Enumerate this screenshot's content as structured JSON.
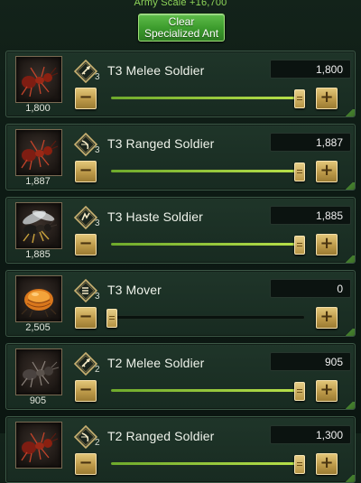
{
  "header": {
    "army_scale": "Army Scale +16,700",
    "clear_button": [
      "Clear",
      "Specialized Ant"
    ]
  },
  "units": [
    {
      "name": "T3 Melee Soldier",
      "tier": "3",
      "count": "1,800",
      "value": "1,800",
      "level": 0.97,
      "icon": "melee-tier-icon",
      "portrait": "red-ant-portrait"
    },
    {
      "name": "T3 Ranged Soldier",
      "tier": "3",
      "count": "1,887",
      "value": "1,887",
      "level": 0.97,
      "icon": "ranged-tier-icon",
      "portrait": "red-ant-portrait"
    },
    {
      "name": "T3 Haste Soldier",
      "tier": "3",
      "count": "1,885",
      "value": "1,885",
      "level": 0.97,
      "icon": "haste-tier-icon",
      "portrait": "winged-ant-portrait"
    },
    {
      "name": "T3 Mover",
      "tier": "3",
      "count": "2,505",
      "value": "0",
      "level": 0.0,
      "icon": "mover-tier-icon",
      "portrait": "honeypot-ant-portrait"
    },
    {
      "name": "T2 Melee Soldier",
      "tier": "2",
      "count": "905",
      "value": "905",
      "level": 0.97,
      "icon": "melee-tier-icon",
      "portrait": "black-ant-portrait"
    },
    {
      "name": "T2 Ranged Soldier",
      "tier": "2",
      "count": "",
      "value": "1,300",
      "level": 0.97,
      "icon": "ranged-tier-icon",
      "portrait": "red-ant-portrait"
    }
  ],
  "controls": {
    "minus": "−",
    "plus": "+"
  },
  "colors": {
    "accent_green": "#8fd65a",
    "button_gold": "#c9a552",
    "track_fill": "#9ccc3f"
  }
}
